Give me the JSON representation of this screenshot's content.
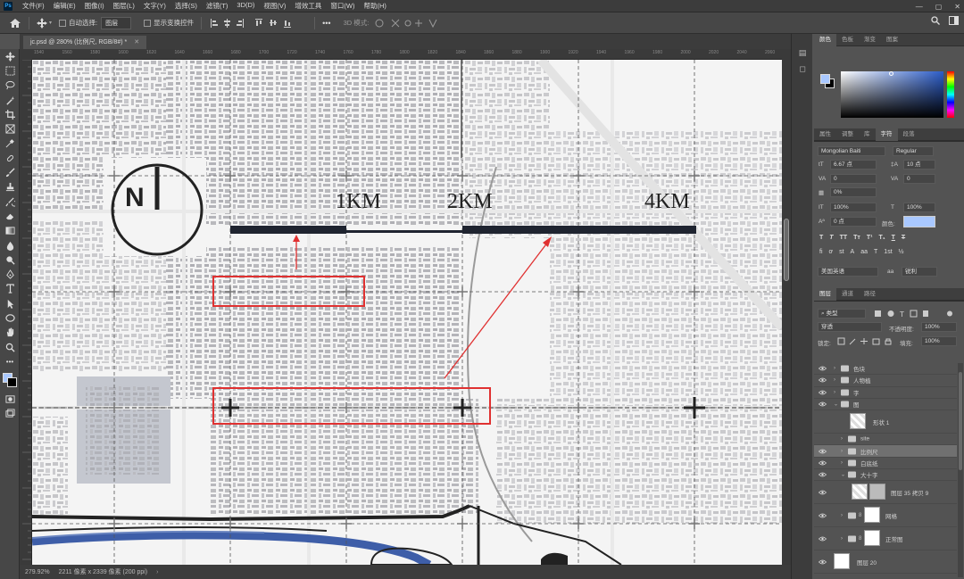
{
  "menu": [
    "文件(F)",
    "编辑(E)",
    "图像(I)",
    "图层(L)",
    "文字(Y)",
    "选择(S)",
    "滤镜(T)",
    "3D(D)",
    "视图(V)",
    "增效工具",
    "窗口(W)",
    "帮助(H)"
  ],
  "options": {
    "auto_select_label": "自动选择:",
    "auto_select_value": "图层",
    "show_transform_label": "显示变换控件",
    "mode_3d_label": "3D 模式:"
  },
  "document": {
    "tab_title": "jc.psd @ 280% (比例尺, RGB/8#) *",
    "zoom": "279.92%",
    "dims": "2211 像素 x 2339 像素 (200 ppi)"
  },
  "hruler_labels": [
    "1540",
    "1560",
    "1580",
    "1600",
    "1620",
    "1640",
    "1660",
    "1680",
    "1700",
    "1720",
    "1740",
    "1760",
    "1780",
    "1800",
    "1820",
    "1840",
    "1860",
    "1880",
    "1900",
    "1920",
    "1940",
    "1960",
    "1980",
    "2000",
    "2020",
    "2040",
    "2060"
  ],
  "canvas": {
    "north_label": "N",
    "scale_labels": [
      "1KM",
      "2KM",
      "4KM"
    ]
  },
  "color_panel": {
    "tabs": [
      "颜色",
      "色板",
      "渐变",
      "图案"
    ],
    "fg_color": "#a9c8ff",
    "bg_color": "#000000"
  },
  "char_panel": {
    "tabs": [
      "属性",
      "调整",
      "库",
      "字符",
      "段落"
    ],
    "font_family": "Mongolian Baiti",
    "font_style": "Regular",
    "font_size": "6.67 点",
    "leading": "10 点",
    "kerning": "0",
    "tracking": "0%",
    "vertical_scale": "100%",
    "horizontal_scale": "100%",
    "baseline_shift": "0 点",
    "color_label": "颜色:",
    "language": "美国英语",
    "antialias": "锐利",
    "aa_label": "aa"
  },
  "layers_panel": {
    "tabs": [
      "图层",
      "通道",
      "路径"
    ],
    "filter": "类型",
    "blend_mode": "穿透",
    "opacity_label": "不透明度:",
    "opacity": "100%",
    "lock_label": "锁定:",
    "fill_label": "填充:",
    "fill": "100%",
    "layers": [
      {
        "name": "色块",
        "visible": true,
        "type": "group",
        "indent": 0
      },
      {
        "name": "人物植",
        "visible": true,
        "type": "group",
        "indent": 0
      },
      {
        "name": "字",
        "visible": true,
        "type": "group",
        "indent": 0
      },
      {
        "name": "图",
        "visible": true,
        "type": "group-open",
        "indent": 0
      },
      {
        "name": "形状 1",
        "visible": false,
        "type": "shape",
        "indent": 1
      },
      {
        "name": "site",
        "visible": false,
        "type": "group",
        "indent": 1
      },
      {
        "name": "比例尺",
        "visible": true,
        "type": "group",
        "indent": 1,
        "selected": true
      },
      {
        "name": "白底纸",
        "visible": true,
        "type": "group",
        "indent": 1
      },
      {
        "name": "大十字",
        "visible": true,
        "type": "group-open",
        "indent": 1
      },
      {
        "name": "图层 35 拷贝 9",
        "visible": true,
        "type": "pixel",
        "indent": 2
      },
      {
        "name": "网格",
        "visible": true,
        "type": "group-mask",
        "indent": 1
      },
      {
        "name": "正常图",
        "visible": true,
        "type": "group-mask",
        "indent": 1
      },
      {
        "name": "图层 20",
        "visible": true,
        "type": "pixel",
        "indent": 0
      }
    ]
  }
}
